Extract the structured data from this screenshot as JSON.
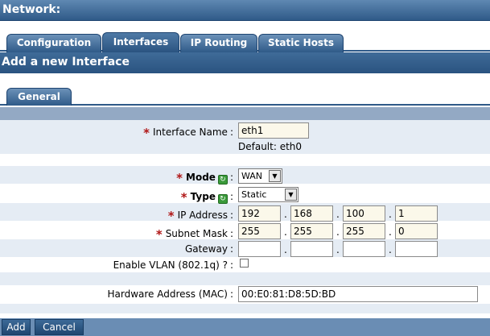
{
  "header": {
    "title": "Network:"
  },
  "tabs": [
    {
      "label": "Configuration"
    },
    {
      "label": "Interfaces"
    },
    {
      "label": "IP Routing"
    },
    {
      "label": "Static Hosts"
    }
  ],
  "section": {
    "title": "Add a new Interface"
  },
  "subtab": {
    "label": "General"
  },
  "form": {
    "interface_name": {
      "label": "Interface Name",
      "value": "eth1",
      "default_note": "Default: eth0"
    },
    "mode": {
      "label": "Mode",
      "value": "WAN"
    },
    "type": {
      "label": "Type",
      "value": "Static"
    },
    "ip_address": {
      "label": "IP Address",
      "octets": [
        "192",
        "168",
        "100",
        "1"
      ]
    },
    "subnet_mask": {
      "label": "Subnet Mask",
      "octets": [
        "255",
        "255",
        "255",
        "0"
      ]
    },
    "gateway": {
      "label": "Gateway",
      "octets": [
        "",
        "",
        "",
        ""
      ]
    },
    "vlan": {
      "label": "Enable VLAN (802.1q) ?",
      "checked": false
    },
    "mac": {
      "label": "Hardware Address (MAC)",
      "value": "00:E0:81:D8:5D:BD"
    },
    "colon": ":",
    "required_mark": "*",
    "dot": "."
  },
  "buttons": {
    "add": "Add",
    "cancel": "Cancel"
  },
  "icons": {
    "refresh": "refresh-icon"
  },
  "colors": {
    "header_bg": "#2f5a88",
    "band_light": "#e5ecf4",
    "band_dark": "#93a9c4",
    "input_bg": "#fbf8ea",
    "required": "#b01616"
  }
}
